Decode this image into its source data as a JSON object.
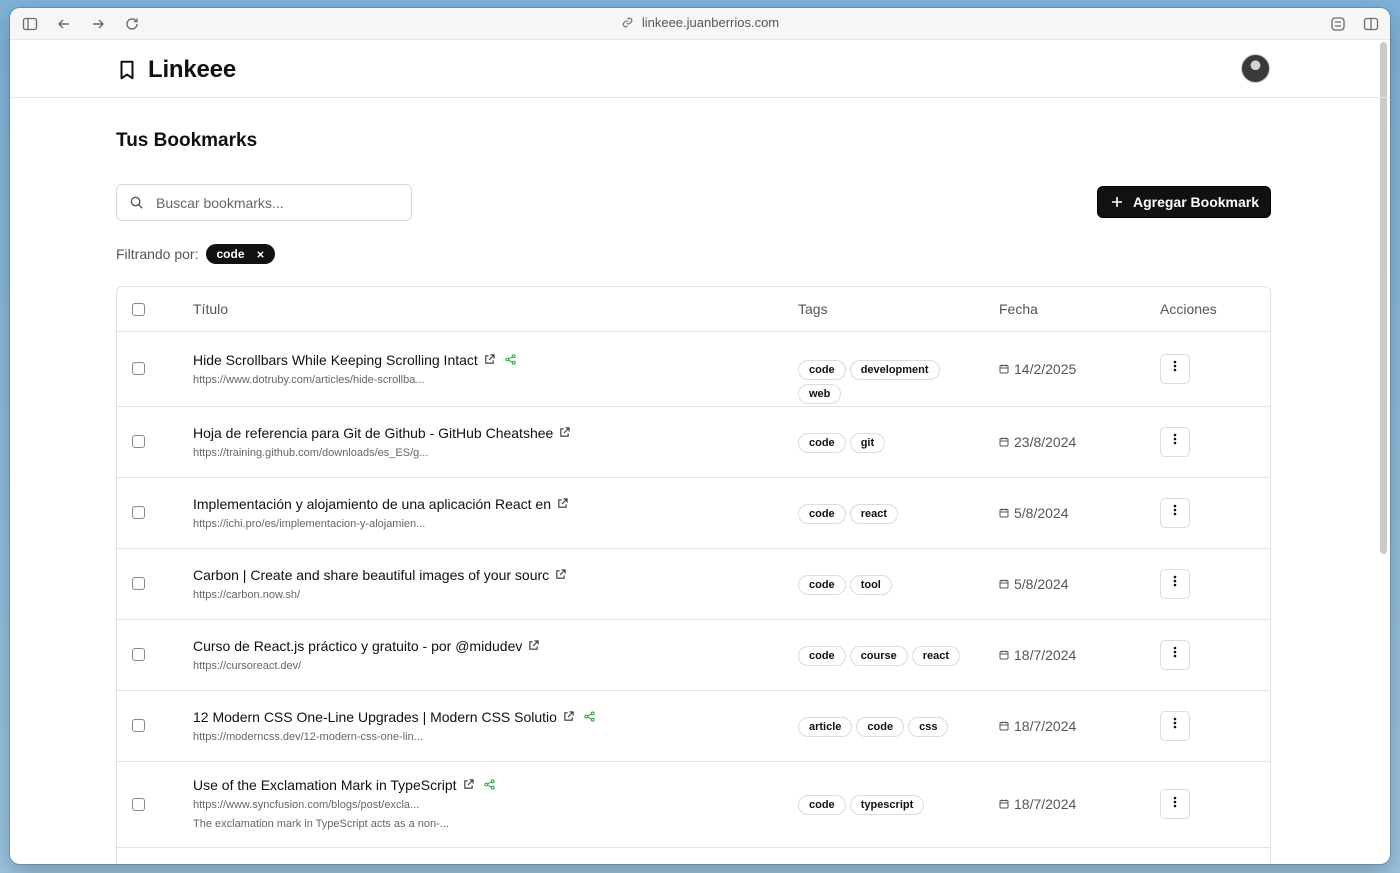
{
  "browser": {
    "url": "linkeee.juanberrios.com"
  },
  "app": {
    "name": "Linkeee"
  },
  "page": {
    "title": "Tus Bookmarks",
    "search_placeholder": "Buscar bookmarks...",
    "add_button_label": "Agregar Bookmark",
    "filter_label": "Filtrando por:",
    "active_filter": "code"
  },
  "table": {
    "headers": {
      "title": "Título",
      "tags": "Tags",
      "date": "Fecha",
      "actions": "Acciones"
    },
    "rows": [
      {
        "title": "Hide Scrollbars While Keeping Scrolling Intact",
        "url": "https://www.dotruby.com/articles/hide-scrollba...",
        "shared": true,
        "tags": [
          "code",
          "development",
          "web"
        ],
        "date": "14/2/2025"
      },
      {
        "title": "Hoja de referencia para Git de Github - GitHub Cheatshee",
        "url": "https://training.github.com/downloads/es_ES/g...",
        "shared": false,
        "tags": [
          "code",
          "git"
        ],
        "date": "23/8/2024"
      },
      {
        "title": "Implementación y alojamiento de una aplicación React en",
        "url": "https://ichi.pro/es/implementacion-y-alojamien...",
        "shared": false,
        "tags": [
          "code",
          "react"
        ],
        "date": "5/8/2024"
      },
      {
        "title": "Carbon | Create and share beautiful images of your sourc",
        "url": "https://carbon.now.sh/",
        "shared": false,
        "tags": [
          "code",
          "tool"
        ],
        "date": "5/8/2024"
      },
      {
        "title": "Curso de React.js práctico y gratuito - por @midudev",
        "url": "https://cursoreact.dev/",
        "shared": false,
        "tags": [
          "code",
          "course",
          "react"
        ],
        "date": "18/7/2024"
      },
      {
        "title": "12 Modern CSS One-Line Upgrades | Modern CSS Solutio",
        "url": "https://moderncss.dev/12-modern-css-one-lin...",
        "shared": true,
        "tags": [
          "article",
          "code",
          "css"
        ],
        "date": "18/7/2024"
      },
      {
        "title": "Use of the Exclamation Mark in TypeScript",
        "url": "https://www.syncfusion.com/blogs/post/excla...",
        "description": "The exclamation mark in TypeScript acts as a non-...",
        "shared": true,
        "tags": [
          "code",
          "typescript"
        ],
        "date": "18/7/2024"
      }
    ]
  },
  "colors": {
    "primary": "#111111",
    "share_icon": "#2fa84f",
    "border": "#e3e3e3"
  }
}
